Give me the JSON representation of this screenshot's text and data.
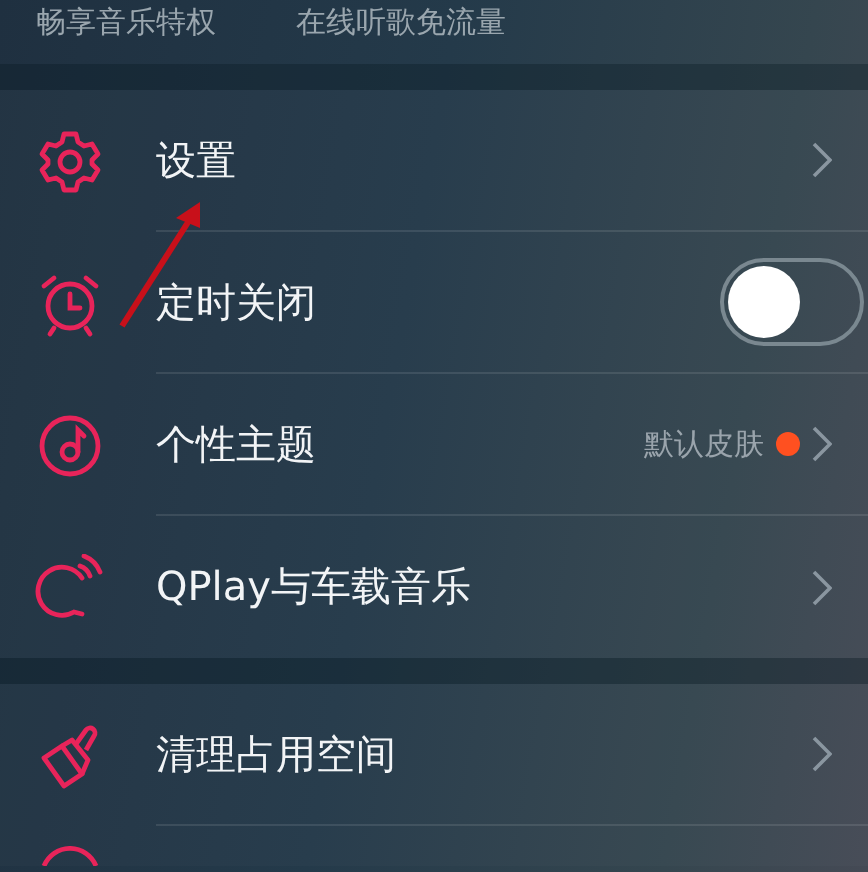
{
  "header": {
    "items": [
      "畅享音乐特权",
      "在线听歌免流量"
    ]
  },
  "groups": [
    {
      "rows": [
        {
          "kind": "link",
          "label": "设置"
        },
        {
          "kind": "toggle",
          "label": "定时关闭",
          "on": false
        },
        {
          "kind": "link",
          "label": "个性主题",
          "value": "默认皮肤",
          "dot": true
        },
        {
          "kind": "link",
          "label": "QPlay与车载音乐"
        }
      ]
    },
    {
      "rows": [
        {
          "kind": "link",
          "label": "清理占用空间"
        },
        {
          "kind": "partial"
        }
      ]
    }
  ]
}
